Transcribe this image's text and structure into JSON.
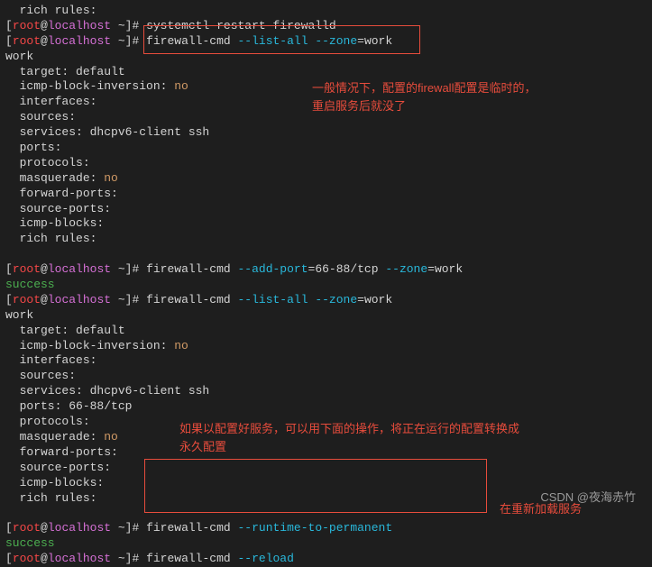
{
  "prompt": {
    "lb": "[",
    "user": "root",
    "at": "@",
    "host": "localhost",
    "dir": " ~]# "
  },
  "lines": {
    "l0": "  rich rules:",
    "blank": "",
    "cmd_restart": "systemctl restart firewalld",
    "cmd_listall_pre": "firewall-cmd ",
    "flag_listall": "--list-all",
    "sp": " ",
    "flag_zone": "--zone",
    "eq_work": "=work",
    "work": "work",
    "target": "  target: default",
    "icmp_inv": "  icmp-block-inversion: ",
    "no": "no",
    "ifaces": "  interfaces:",
    "sources": "  sources:",
    "services": "  services: dhcpv6-client ssh",
    "ports": "  ports:",
    "ports2": "  ports: 66-88/tcp",
    "protocols": "  protocols:",
    "masq": "  masquerade: ",
    "fwdports": "  forward-ports:",
    "srcports": "  source-ports:",
    "icmpblk": "  icmp-blocks:",
    "richrules": "  rich rules:",
    "flag_addport": "--add-port",
    "eq_portrange": "=66-88/tcp ",
    "success": "success",
    "flag_r2p": "--runtime-to-permanent",
    "flag_reload": "--reload"
  },
  "annotations": {
    "a1_l1": "一般情况下，配置的firewall配置是临时的，",
    "a1_l2": "重启服务后就没了",
    "a2_l1": "如果以配置好服务，可以用下面的操作，将正在运行的配置转换成",
    "a2_l2": "永久配置",
    "a3": "在重新加载服务"
  },
  "watermark": "CSDN @夜海赤竹"
}
